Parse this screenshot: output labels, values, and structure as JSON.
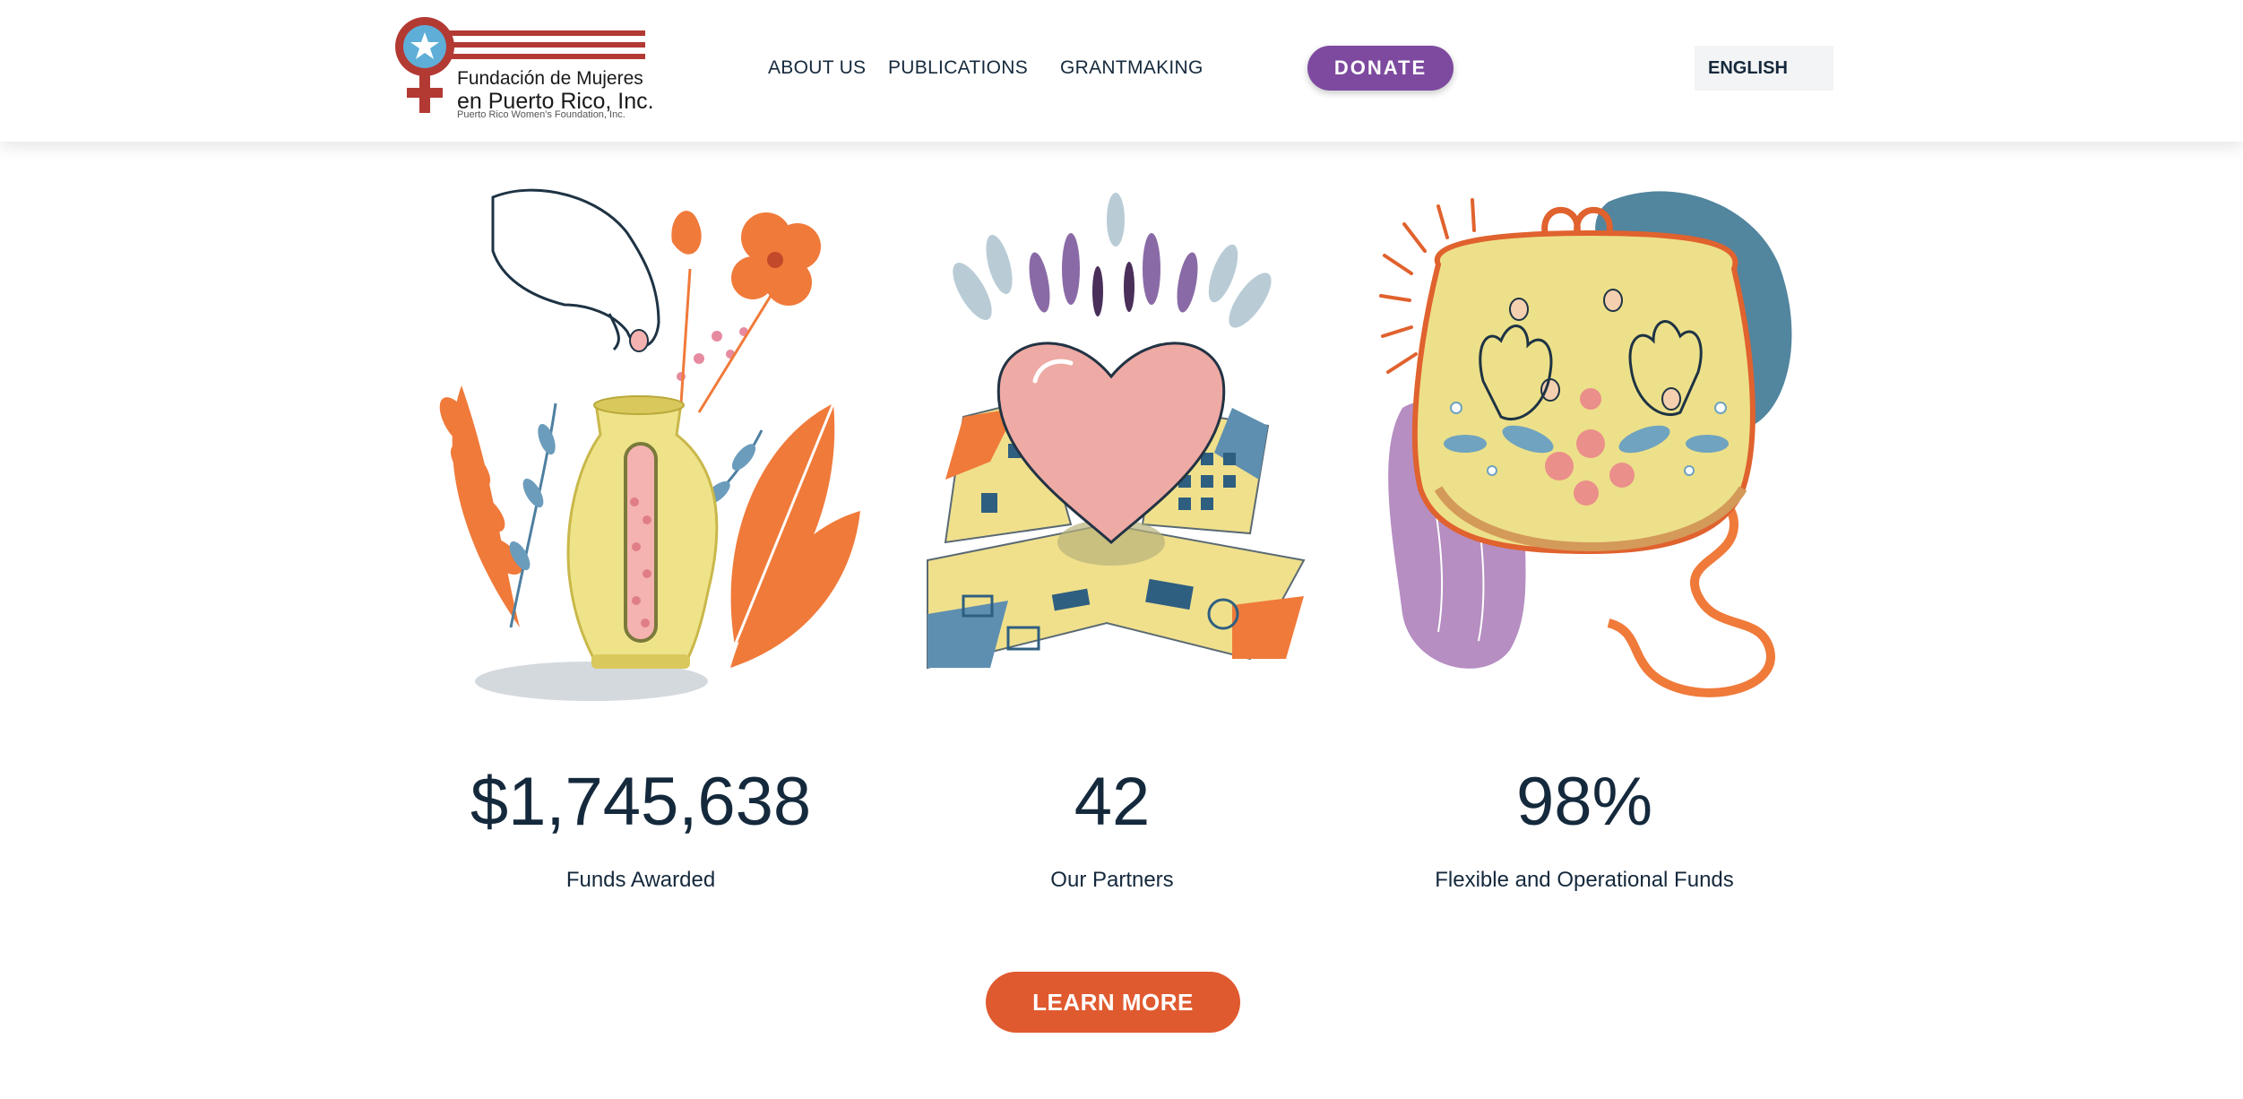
{
  "header": {
    "logo": {
      "line1": "Fundación de Mujeres",
      "line2": "en Puerto Rico, Inc.",
      "line3": "Puerto Rico Women's Foundation, Inc."
    },
    "nav": {
      "about": "ABOUT US",
      "publications": "PUBLICATIONS",
      "grantmaking": "GRANTMAKING"
    },
    "donate_label": "DONATE",
    "language": "ENGLISH"
  },
  "stats": [
    {
      "value": "$1,745,638",
      "label": "Funds Awarded",
      "illustration": "vase-hand-illustration"
    },
    {
      "value": "42",
      "label": "Our Partners",
      "illustration": "heart-house-illustration"
    },
    {
      "value": "98%",
      "label": "Flexible and Operational Funds",
      "illustration": "coin-purse-illustration"
    }
  ],
  "cta": {
    "learn_more": "LEARN MORE"
  },
  "colors": {
    "navy": "#15293c",
    "donate_purple": "#7e4a9f",
    "cta_orange": "#e05a2f",
    "logo_red": "#b23a33",
    "logo_blue": "#5eaed8"
  }
}
